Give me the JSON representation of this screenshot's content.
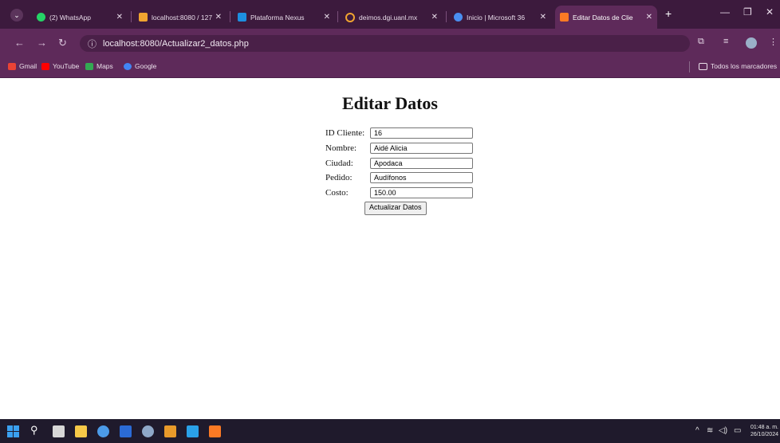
{
  "browser": {
    "tabs": [
      {
        "label": "(2) WhatsApp",
        "icon": "whatsapp-icon",
        "color": "#25d366"
      },
      {
        "label": "localhost:8080 / 127",
        "icon": "phpmyadmin-icon",
        "color": "#f0a430"
      },
      {
        "label": "Plataforma Nexus",
        "icon": "nexus-icon",
        "color": "#1d8fe0"
      },
      {
        "label": "deimos.dgi.uanl.mx",
        "icon": "deimos-icon",
        "color": "#f0a430"
      },
      {
        "label": "Inicio | Microsoft 36",
        "icon": "microsoft-icon",
        "color": "#4a8ef0"
      },
      {
        "label": "Editar Datos de Clie",
        "icon": "xampp-icon",
        "color": "#fb7a24",
        "active": true
      }
    ],
    "url": "localhost:8080/Actualizar2_datos.php",
    "bookmarks": [
      {
        "label": "Gmail",
        "icon": "gmail-icon",
        "color": "#ea4335"
      },
      {
        "label": "YouTube",
        "icon": "youtube-icon",
        "color": "#ff0000"
      },
      {
        "label": "Maps",
        "icon": "maps-icon",
        "color": "#34a853"
      },
      {
        "label": "Google",
        "icon": "google-icon",
        "color": "#4285f4"
      }
    ],
    "all_bookmarks": "Todos los marcadores"
  },
  "page": {
    "title": "Editar Datos",
    "fields": [
      {
        "label": "ID Cliente:",
        "value": "16"
      },
      {
        "label": "Nombre:",
        "value": "Aidé Alicia"
      },
      {
        "label": "Ciudad:",
        "value": "Apodaca"
      },
      {
        "label": "Pedido:",
        "value": "Audífonos"
      },
      {
        "label": "Costo:",
        "value": "150.00"
      }
    ],
    "submit_label": "Actualizar Datos"
  },
  "taskbar": {
    "time": "01:48 a. m.",
    "date": "26/10/2024"
  }
}
